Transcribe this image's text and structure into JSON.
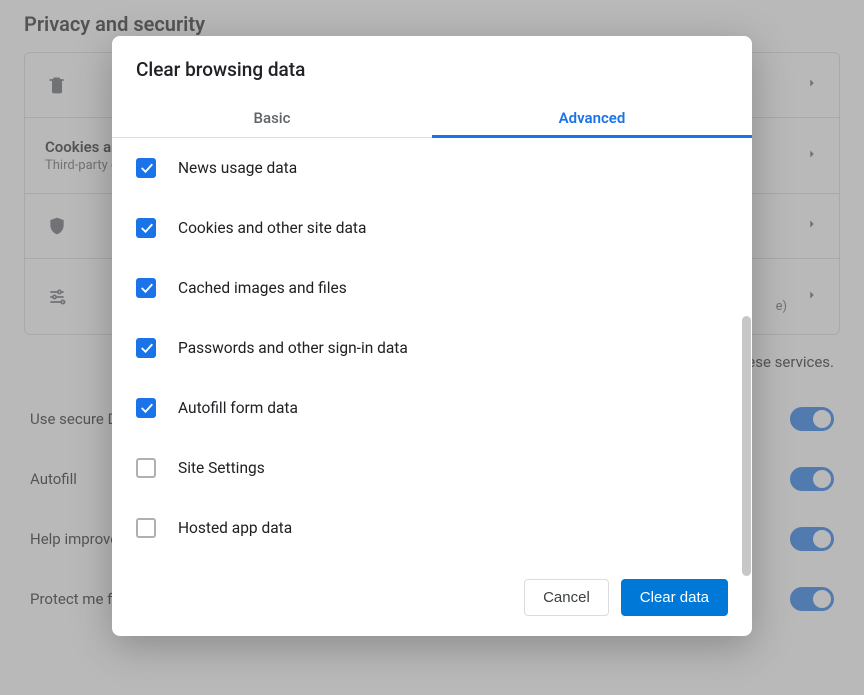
{
  "page": {
    "heading": "Privacy and security",
    "rows": [
      {
        "title": "",
        "sub": ""
      },
      {
        "title": "Cookies and site data",
        "sub": "Third-party cookies are blocked"
      },
      {
        "title": "",
        "sub": "e)"
      },
      {
        "title": "",
        "sub": ""
      }
    ],
    "services_note_tail": "e these services.",
    "toggles": [
      "Use secure DNS",
      "Autofill",
      "Help improve security",
      "Protect me from malicious sites"
    ]
  },
  "dialog": {
    "title": "Clear browsing data",
    "tabs": {
      "basic": "Basic",
      "advanced": "Advanced",
      "active": "advanced"
    },
    "options": [
      {
        "label": "News usage data",
        "checked": true
      },
      {
        "label": "Cookies and other site data",
        "checked": true
      },
      {
        "label": "Cached images and files",
        "checked": true
      },
      {
        "label": "Passwords and other sign-in data",
        "checked": true
      },
      {
        "label": "Autofill form data",
        "checked": true
      },
      {
        "label": "Site Settings",
        "checked": false
      },
      {
        "label": "Hosted app data",
        "checked": false
      }
    ],
    "buttons": {
      "cancel": "Cancel",
      "clear": "Clear data"
    }
  },
  "colors": {
    "accent": "#1a73e8",
    "primary_button": "#0078d7",
    "border": "#dadce0",
    "text_secondary": "#5f6368"
  }
}
